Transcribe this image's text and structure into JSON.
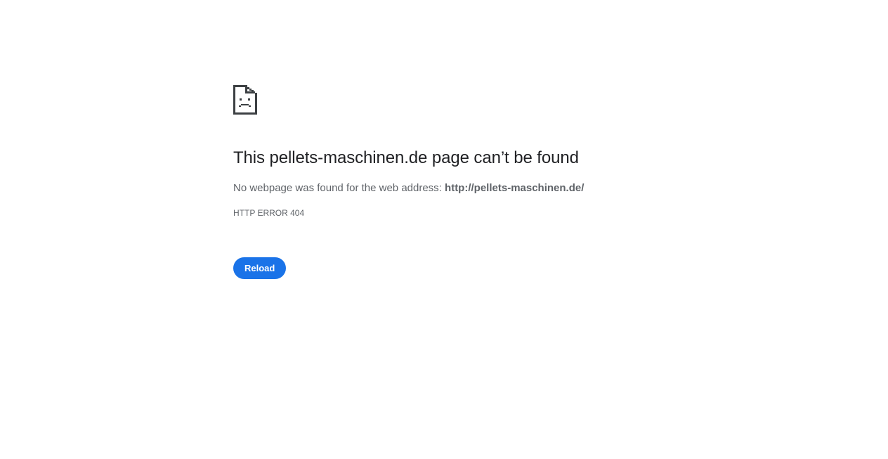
{
  "icon": "sad-document-icon",
  "colors": {
    "title": "#202124",
    "text": "#5f6368",
    "icon": "#3c4043",
    "button_bg": "#1a73e8",
    "button_text": "#ffffff"
  },
  "error": {
    "title": "This pellets-maschinen.de page can’t be found",
    "message_prefix": "No webpage was found for the web address: ",
    "url": "http://pellets-maschinen.de/",
    "code": "HTTP ERROR 404"
  },
  "actions": {
    "reload_label": "Reload"
  }
}
